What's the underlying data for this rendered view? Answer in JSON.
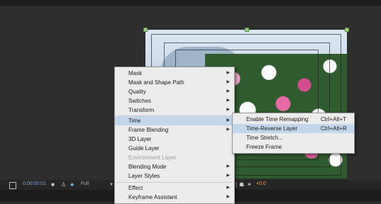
{
  "viewer": {
    "zoom_timecode": "0:00:00:01",
    "resolution": "Full",
    "offset_value": "+0.0"
  },
  "context_menu": {
    "items": [
      {
        "label": "Mask",
        "has_submenu": true
      },
      {
        "label": "Mask and Shape Path",
        "has_submenu": true
      },
      {
        "label": "Quality",
        "has_submenu": true
      },
      {
        "label": "Switches",
        "has_submenu": true
      },
      {
        "label": "Transform",
        "has_submenu": true
      },
      {
        "label": "Time",
        "has_submenu": true,
        "highlighted": true
      },
      {
        "label": "Frame Blending",
        "has_submenu": true
      },
      {
        "label": "3D Layer",
        "has_submenu": false
      },
      {
        "label": "Guide Layer",
        "has_submenu": false
      },
      {
        "label": "Environment Layer",
        "has_submenu": false,
        "disabled": true
      },
      {
        "label": "Blending Mode",
        "has_submenu": true
      },
      {
        "label": "Layer Styles",
        "has_submenu": true
      },
      {
        "label": "Effect",
        "has_submenu": true
      },
      {
        "label": "Keyframe Assistant",
        "has_submenu": true
      }
    ]
  },
  "time_submenu": {
    "items": [
      {
        "label": "Enable Time Remapping",
        "shortcut": "Ctrl+Alt+T"
      },
      {
        "label": "Time-Reverse Layer",
        "shortcut": "Ctrl+Alt+R",
        "highlighted": true
      },
      {
        "label": "Time Stretch...",
        "shortcut": ""
      },
      {
        "label": "Freeze Frame",
        "shortcut": ""
      }
    ]
  },
  "colors": {
    "menu_bg": "#ececec",
    "menu_highlight": "#c4d6ec",
    "panel_bg": "#2e2e2e",
    "timecode_blue": "#8aa3c8",
    "offset_orange": "#e8a640"
  },
  "icons": {
    "submenu_arrow": "triangle-right",
    "snapshot": "camera",
    "color_channels": "rgb-dots",
    "exposure": "sun"
  }
}
